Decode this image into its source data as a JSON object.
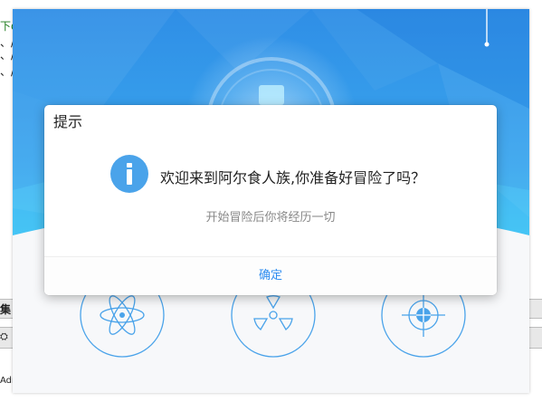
{
  "background_window": {
    "left_fragments": [
      "下di",
      "、/",
      "、/",
      "、/",
      "集",
      "⛭",
      "Adm"
    ],
    "colors": {
      "link_green": "#1a7a1a",
      "bar": "#e8e8e8"
    }
  },
  "app": {
    "colors": {
      "hero_top": "#2f8ee6",
      "hero_bottom": "#3fc8f4",
      "tool_stroke": "#4aa3ea",
      "accent": "#2d8cf0"
    },
    "tools": [
      {
        "icon": "atom-icon"
      },
      {
        "icon": "radiation-icon"
      },
      {
        "icon": "crosshair-icon"
      }
    ]
  },
  "dialog": {
    "title": "提示",
    "icon": "info-icon",
    "message": "欢迎来到阿尔食人族,你准备好冒险了吗？",
    "sub_message": "开始冒险后你将经历一切",
    "confirm_label": "确定"
  }
}
